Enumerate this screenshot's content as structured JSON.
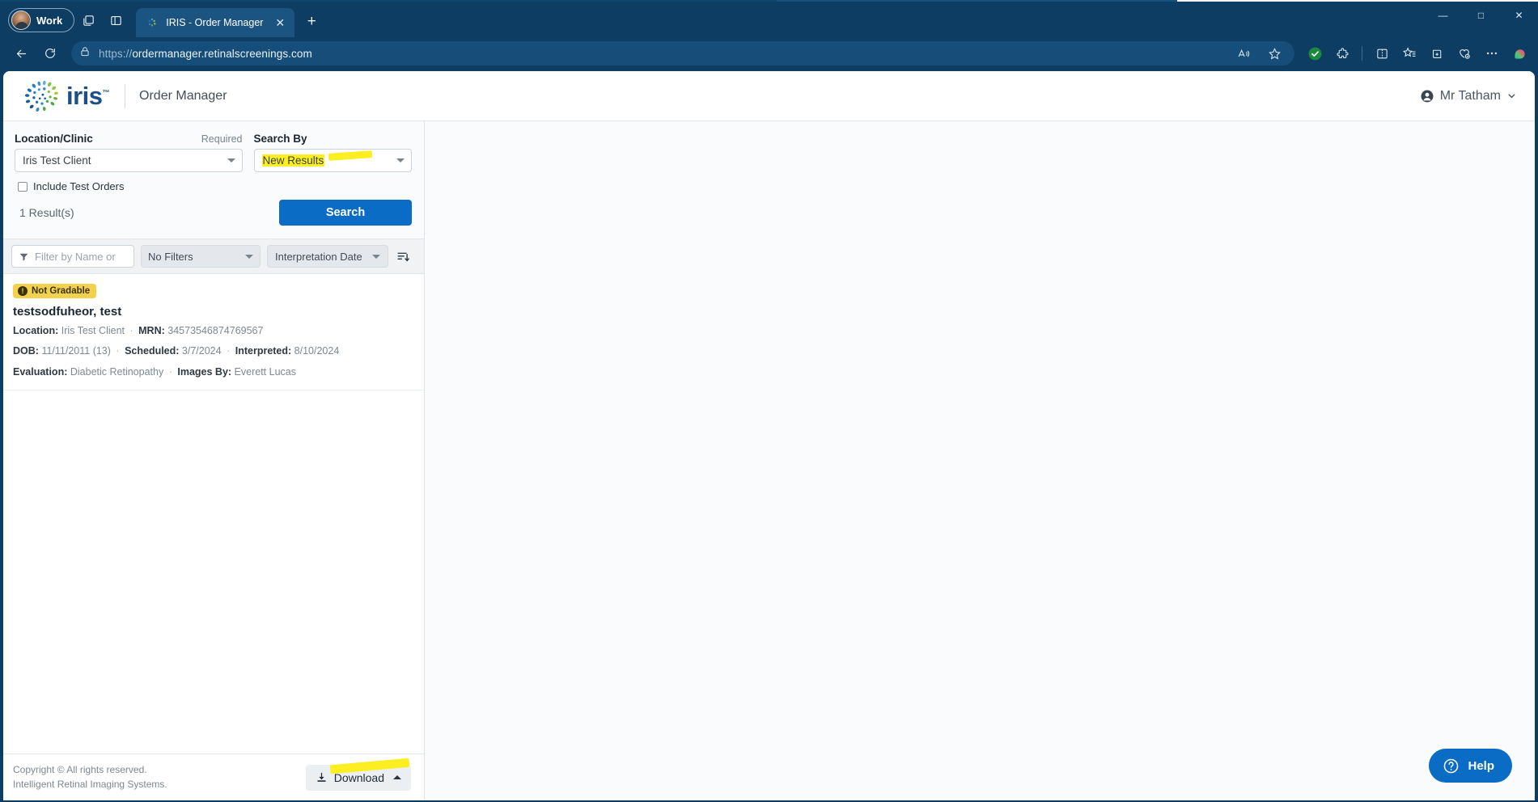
{
  "browser": {
    "workspace_label": "Work",
    "tab": {
      "title": "IRIS - Order Manager",
      "close": "✕"
    },
    "new_tab": "+",
    "window_controls": {
      "minimize": "—",
      "maximize": "□",
      "close": "✕"
    },
    "url_scheme": "https://",
    "url_host": "ordermanager.retinalscreenings.com",
    "icons": {
      "copilot": "copilot-icon",
      "workspaces": "workspaces-icon",
      "split": "split-screen-icon",
      "back": "back-arrow-icon",
      "reload": "reload-icon",
      "lock": "site-info-lock-icon",
      "read_aloud": "read-aloud-icon",
      "favorite": "add-favorite-star-icon",
      "checkmark": "verified-check-icon",
      "extensions": "extensions-puzzle-icon",
      "favorites_list": "favorites-icon",
      "collections": "collections-icon",
      "browser_essentials": "browser-essentials-icon",
      "settings_more": "more-options-icon"
    }
  },
  "app": {
    "brand_word": "iris",
    "brand_tm": "™",
    "title": "Order Manager",
    "user": {
      "name": "Mr Tatham",
      "caret": "⌄"
    }
  },
  "search": {
    "location": {
      "label": "Location/Clinic",
      "required_text": "Required",
      "value": "Iris Test Client"
    },
    "search_by": {
      "label": "Search By",
      "value": "New Results",
      "highlighted": true
    },
    "include_test_orders": {
      "label": "Include Test Orders",
      "checked": false
    },
    "result_count": "1 Result(s)",
    "search_button": "Search"
  },
  "filters": {
    "name_filter_placeholder": "Filter by Name or",
    "filter_select": "No Filters",
    "sort_select": "Interpretation Date",
    "sort_icon": "sort-descending-icon"
  },
  "results": [
    {
      "badge": "Not Gradable",
      "patient_name": "testsodfuheor, test",
      "location_label": "Location:",
      "location_value": "Iris Test Client",
      "mrn_label": "MRN:",
      "mrn_value": "34573546874769567",
      "dob_label": "DOB:",
      "dob_value": "11/11/2011 (13)",
      "scheduled_label": "Scheduled:",
      "scheduled_value": "3/7/2024",
      "interpreted_label": "Interpreted:",
      "interpreted_value": "8/10/2024",
      "evaluation_label": "Evaluation:",
      "evaluation_value": "Diabetic Retinopathy",
      "images_by_label": "Images By:",
      "images_by_value": "Everett Lucas",
      "separator": "·"
    }
  ],
  "footer": {
    "copyright_line1": "Copyright © All rights reserved.",
    "copyright_line2": "Intelligent Retinal Imaging Systems.",
    "download_label": "Download"
  },
  "help": {
    "label": "Help",
    "icon": "question-circle-icon"
  },
  "colors": {
    "accent_blue": "#0a6cc4",
    "browser_chrome": "#0d3d63",
    "badge_yellow": "#f2d14f",
    "highlighter": "#fcee21",
    "brand_blue": "#1b4f86"
  }
}
